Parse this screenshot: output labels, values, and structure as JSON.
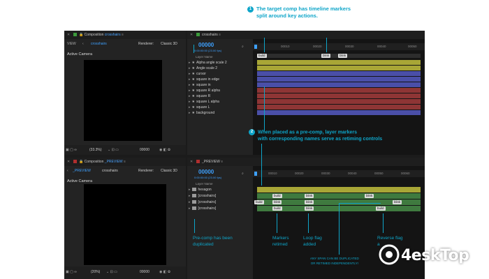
{
  "annotations": {
    "a1_num": "1",
    "a1_line1": "The target comp has timeline markers",
    "a1_line2": "split around key actions.",
    "a2_num": "2",
    "a2_line1": "When placed as a pre-comp, layer markers",
    "a2_line2": "with corresponding names serve as retiming controls",
    "precomp_dup_l1": "Pre-comp has been",
    "precomp_dup_l2": "duplicated",
    "markers_retimed_l1": "Markers",
    "markers_retimed_l2": "retimed",
    "loop_flag_l1": "Loop flag",
    "loop_flag_l2": "added",
    "reverse_flag_l1": "Reverse flag",
    "reverse_flag_l2": "a",
    "any_span_l1": "ANY SPAN CAN BE DUPLICATED",
    "any_span_l2": "OR RETIMED INDEPENDENTLY!"
  },
  "top_comp": {
    "tab_label": "Composition",
    "tab_name": "crosshairs",
    "view_label": "VIEW",
    "breadcrumb": "crosshairs",
    "renderer_label": "Renderer:",
    "renderer_value": "Classic 3D",
    "camera_label": "Active Camera",
    "zoom": "(33.3%)",
    "timecode_small": "00000",
    "timeline_tab": "crosshairs",
    "timecode": "00000",
    "timecode_sub": "0:00:00:00 (23.00 fps)",
    "layer_header": "Layer Name",
    "layers": [
      "Alpha angle scale 2",
      "Angle scale 2",
      "cursor",
      "square in edge",
      "square in",
      "square R alpha",
      "square R",
      "square L alpha",
      "square L",
      "background"
    ],
    "ruler_ticks": [
      "00010",
      "00020",
      "00030",
      "00040",
      "00050"
    ],
    "markers": [
      "build",
      "blink",
      "blink"
    ]
  },
  "bottom_comp": {
    "tab_label": "Composition",
    "tab_name": "_PREVIEW",
    "breadcrumb_active": "_PREVIEW",
    "breadcrumb_2": "crosshairs",
    "renderer_label": "Renderer:",
    "renderer_value": "Classic 3D",
    "camera_label": "Active Camera",
    "zoom": "(20%)",
    "timecode_small": "00000",
    "timeline_tab": "_PREVIEW",
    "timecode": "00000",
    "timecode_sub": "0:00:00:00 (23.00 fps)",
    "layer_header": "Layer Name",
    "layers": [
      "hexagon",
      "[crosshairs]",
      "[crosshairs]",
      "[crosshairs]"
    ],
    "ruler_ticks": [
      "00010",
      "00020",
      "00030",
      "00040",
      "00050",
      "00060"
    ],
    "markers_row2": [
      "build",
      "blink",
      "blink"
    ],
    "markers_row3": [
      "build",
      "blink",
      "blink",
      "blink"
    ],
    "markers_row4": [
      "build",
      "blink",
      "build"
    ]
  },
  "watermark": {
    "text": "4eskTop"
  },
  "colors": {
    "accent": "#0ea5c9",
    "ae_blue": "#3ea1ff",
    "track_yellow": "#a8a636",
    "track_blue": "#4a4fa8",
    "track_red": "#8e3535",
    "track_green": "#3f7a3f"
  }
}
